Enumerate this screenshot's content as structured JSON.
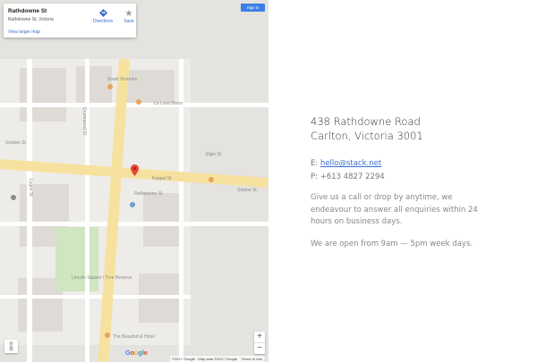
{
  "map": {
    "card": {
      "title": "Rathdowne St",
      "subtitle": "Rathdowne St, Victoria",
      "larger_map_link": "View larger map",
      "directions_label": "Directions",
      "save_label": "Save"
    },
    "signin_label": "Sign in",
    "zoom_in": "+",
    "zoom_out": "−",
    "google_logo": "Google",
    "attribution": "©2017 Google · Map data ©2017 Google",
    "terms": "Terms of Use",
    "labels": {
      "small_victories": "Small Victories",
      "la_luna": "La Luna Bistro",
      "tree_reserve": "Lincoln Square / Tree Reserve",
      "beaufort": "The Beaufort & Hotel",
      "grattan": "Grattan St",
      "rathdowne": "Rathdowne St",
      "station": "Station St",
      "keppel": "Keppel St",
      "elgin": "Elgin St",
      "street_left": "Drummond St",
      "lygon": "Lygon St"
    }
  },
  "contact": {
    "address_line1": "438 Rathdowne Road",
    "address_line2": "Carlton, Victoria 3001",
    "email_prefix": "E:",
    "email": "hello@stack.net",
    "phone": "P: +613 4827 2294",
    "paragraph1": "Give us a call or drop by anytime, we endeavour to answer all enquiries within 24 hours on business days.",
    "paragraph2": "We are open from 9am — 5pm week days."
  }
}
